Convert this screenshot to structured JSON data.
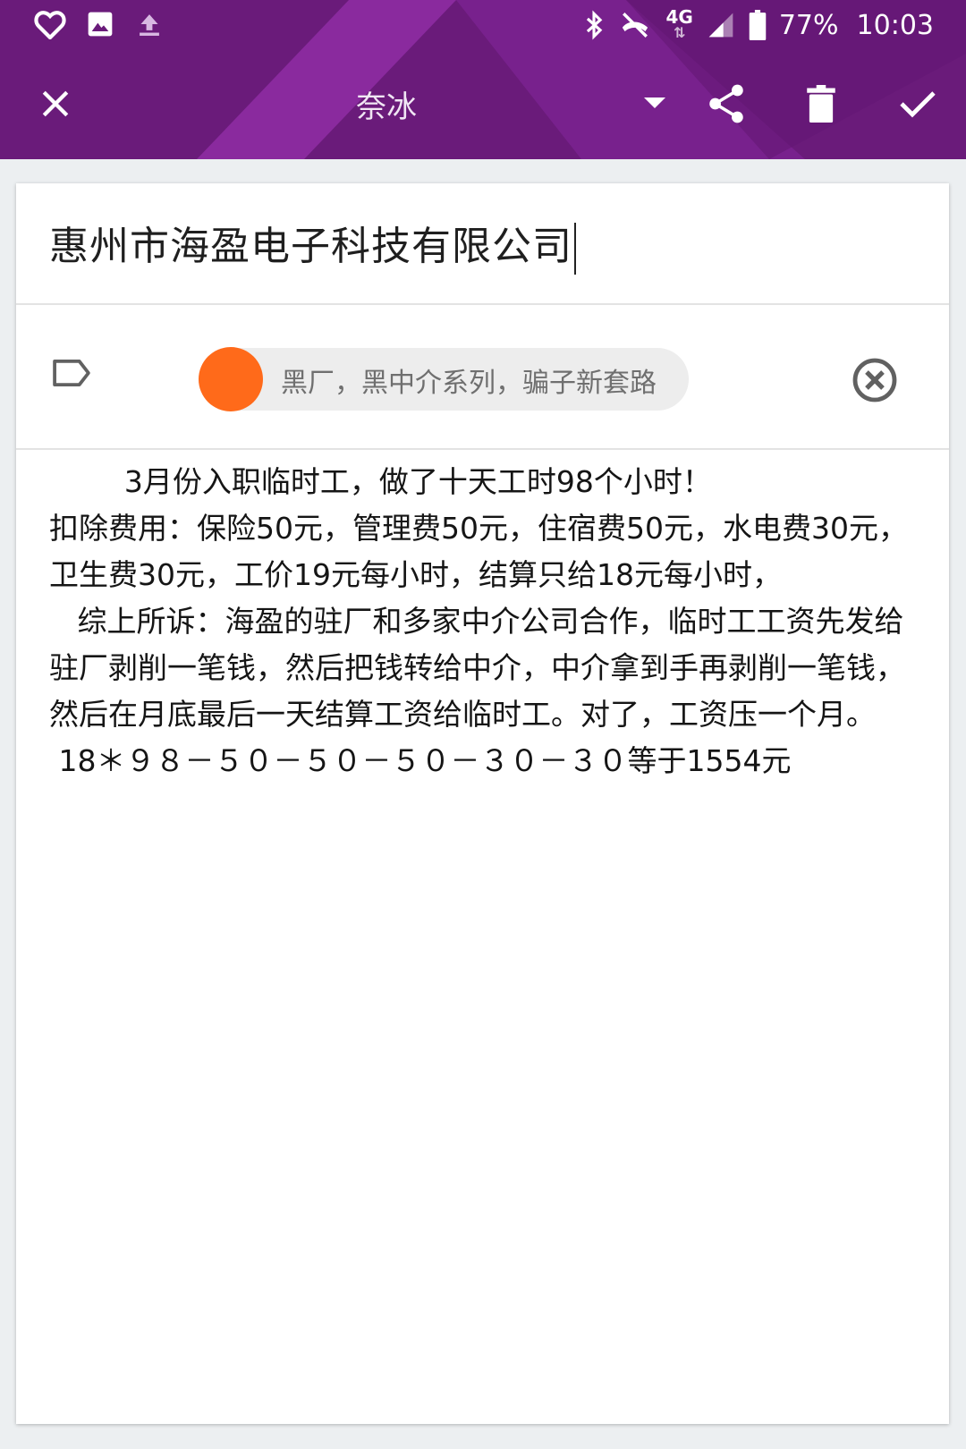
{
  "status_bar": {
    "battery": "77%",
    "time": "10:03",
    "network": "4G",
    "left_icons": [
      "heart-icon",
      "image-icon",
      "upload-icon"
    ],
    "right_icons": [
      "bluetooth-icon",
      "vibrate-off-icon",
      "signal-icon",
      "battery-icon"
    ]
  },
  "app_bar": {
    "account_name": "奈冰",
    "icons": [
      "close-icon",
      "dropdown-arrow-icon",
      "share-icon",
      "delete-icon",
      "check-icon"
    ],
    "color": "#6a1b7a"
  },
  "note": {
    "title": "惠州市海盈电子科技有限公司",
    "label": {
      "text": "黑厂，黑中介系列，骗子新套路",
      "color": "#ff6a1a"
    },
    "body": "        3月份入职临时工，做了十天工时98个小时！\n扣除费用：保险50元，管理费50元，住宿费50元，水电费30元，卫生费30元，工价19元每小时，结算只给18元每小时，\n   综上所诉：海盈的驻厂和多家中介公司合作，临时工工资先发给驻厂剥削一笔钱，然后把钱转给中介，中介拿到手再剥削一笔钱，然后在月底最后一天结算工资给临时工。对了，工资压一个月。\n 18＊９８－５０－５０－５０－３０－３０等于1554元"
  }
}
